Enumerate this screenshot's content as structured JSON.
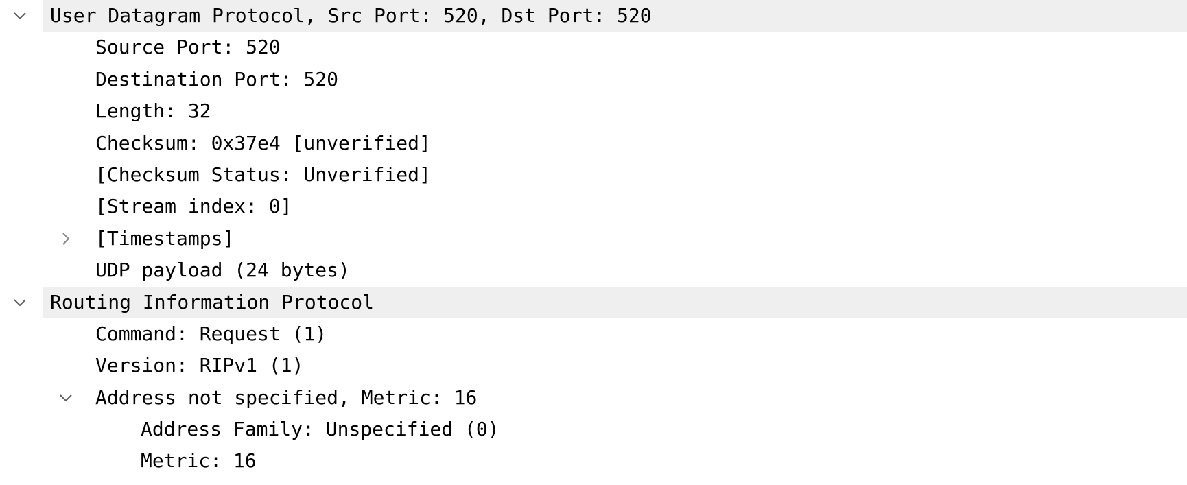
{
  "packet_details": {
    "udp": {
      "header": "User Datagram Protocol, Src Port: 520, Dst Port: 520",
      "fields": {
        "source_port": "Source Port: 520",
        "destination_port": "Destination Port: 520",
        "length": "Length: 32",
        "checksum": "Checksum: 0x37e4 [unverified]",
        "checksum_status": "[Checksum Status: Unverified]",
        "stream_index": "[Stream index: 0]",
        "timestamps": "[Timestamps]",
        "udp_payload": "UDP payload (24 bytes)"
      }
    },
    "rip": {
      "header": "Routing Information Protocol",
      "fields": {
        "command": "Command: Request (1)",
        "version": "Version: RIPv1 (1)",
        "entry": "Address not specified, Metric: 16",
        "entry_address_family": "Address Family: Unspecified (0)",
        "entry_metric": "Metric: 16"
      }
    },
    "colors": {
      "section_header_bg": "#efefef",
      "text": "#000000",
      "expander": "#5f5f5f"
    },
    "icons": {
      "expanded": "chevron-down-icon",
      "collapsed": "chevron-right-icon"
    }
  }
}
